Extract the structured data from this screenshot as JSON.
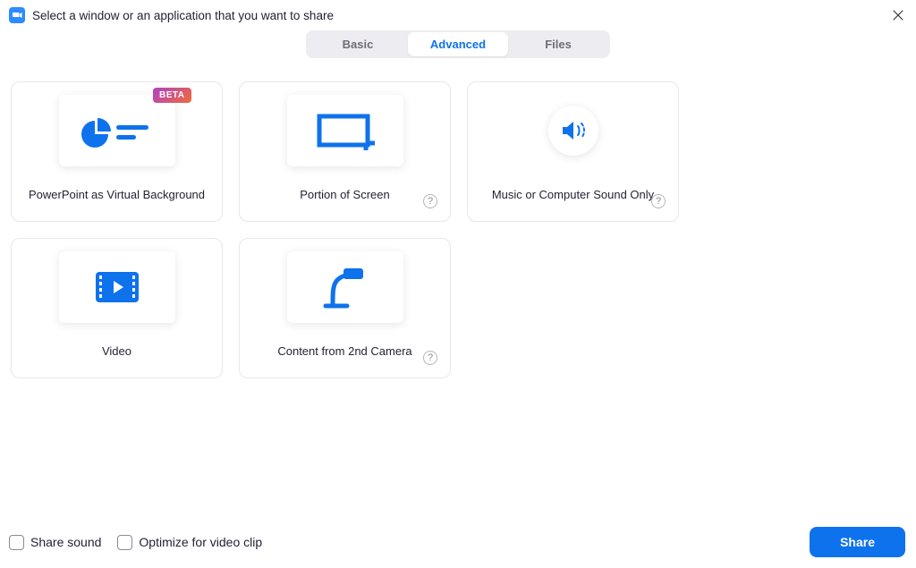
{
  "window": {
    "title": "Select a window or an application that you want to share"
  },
  "tabs": {
    "basic": "Basic",
    "advanced": "Advanced",
    "files": "Files",
    "active": "advanced"
  },
  "options": {
    "ppt_vbg": {
      "label": "PowerPoint as Virtual Background",
      "badge": "BETA"
    },
    "portion": {
      "label": "Portion of Screen"
    },
    "music": {
      "label": "Music or Computer Sound Only"
    },
    "video": {
      "label": "Video"
    },
    "camera2": {
      "label": "Content from 2nd Camera"
    }
  },
  "footer": {
    "share_sound": "Share sound",
    "optimize_clip": "Optimize for video clip",
    "share_button": "Share"
  },
  "glyphs": {
    "help": "?"
  }
}
